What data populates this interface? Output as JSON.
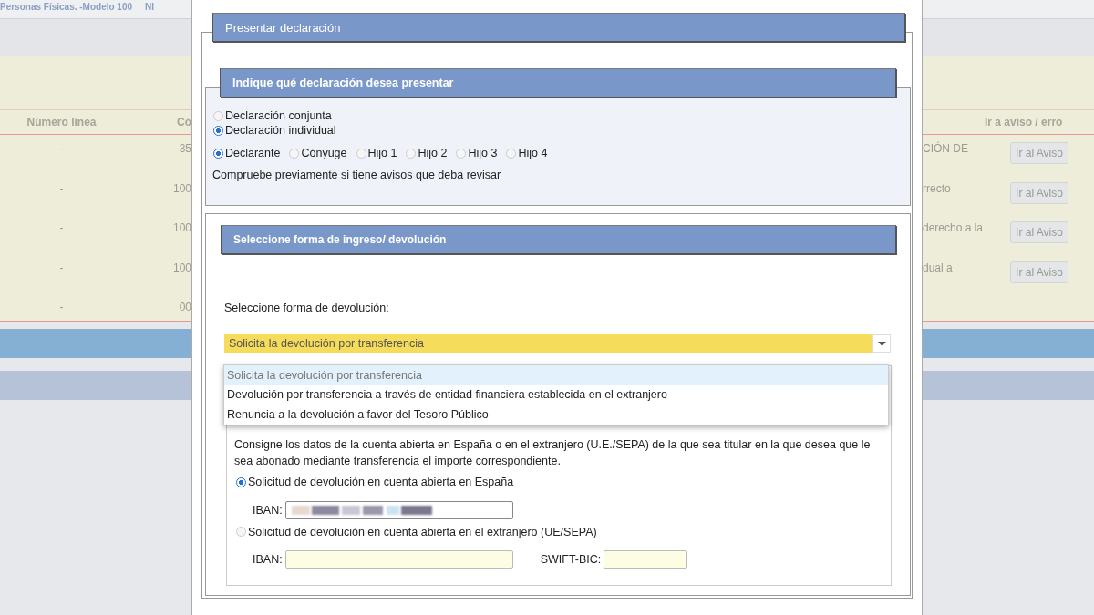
{
  "background": {
    "header_texts": [
      "Personas Físicas. -Modelo 100",
      "NI"
    ],
    "table": {
      "columns": [
        "Número línea",
        "Có",
        "Ir a aviso / erro"
      ],
      "rows": [
        {
          "line": "-",
          "code": "35",
          "description": "CIÓN DE",
          "button": "Ir al Aviso"
        },
        {
          "line": "-",
          "code": "100",
          "description": "rrecto",
          "button": "Ir al Aviso"
        },
        {
          "line": "-",
          "code": "100",
          "description": "derecho a la",
          "button": "Ir al Aviso"
        },
        {
          "line": "-",
          "code": "100",
          "description": "dual a",
          "button": "Ir al Aviso"
        },
        {
          "line": "-",
          "code": "00"
        }
      ]
    }
  },
  "modal": {
    "title": "Presentar declaración",
    "declaration_section": {
      "title": "Indique qué declaración desea presentar",
      "types": [
        {
          "label": "Declaración conjunta",
          "selected": false
        },
        {
          "label": "Declaración individual",
          "selected": true
        }
      ],
      "persons": [
        {
          "label": "Declarante",
          "selected": true
        },
        {
          "label": "Cónyuge",
          "selected": false
        },
        {
          "label": "Hijo 1",
          "selected": false
        },
        {
          "label": "Hijo 2",
          "selected": false
        },
        {
          "label": "Hijo 3",
          "selected": false
        },
        {
          "label": "Hijo 4",
          "selected": false
        }
      ],
      "note": "Compruebe previamente si tiene avisos que deba revisar"
    },
    "payment_section": {
      "title": "Seleccione forma de ingreso/ devolución",
      "select_label": "Seleccione forma de devolución:",
      "select": {
        "value": "Solicita la devolución por transferencia",
        "options": [
          {
            "label": "Solicita la devolución por transferencia",
            "selected": true
          },
          {
            "label": "Devolución por transferencia a través de entidad financiera establecida en el extranjero",
            "selected": false
          },
          {
            "label": "Renuncia a la devolución a favor del Tesoro Público",
            "selected": false
          }
        ]
      },
      "instructions": "Consigne los datos de la cuenta abierta en España o en el extranjero (U.E./SEPA) de la que sea titular en la que desea que le sea abonado mediante transferencia el importe correspondiente.",
      "accounts": [
        {
          "label": "Solicitud de devolución en cuenta abierta en España",
          "selected": true,
          "fields": [
            {
              "label": "IBAN:",
              "kind": "masked"
            }
          ]
        },
        {
          "label": "Solicitud de devolución en cuenta abierta en el extranjero (UE/SEPA)",
          "selected": false,
          "fields": [
            {
              "label": "IBAN:",
              "kind": "empty"
            },
            {
              "label": "SWIFT-BIC:",
              "kind": "empty"
            }
          ]
        }
      ]
    }
  }
}
